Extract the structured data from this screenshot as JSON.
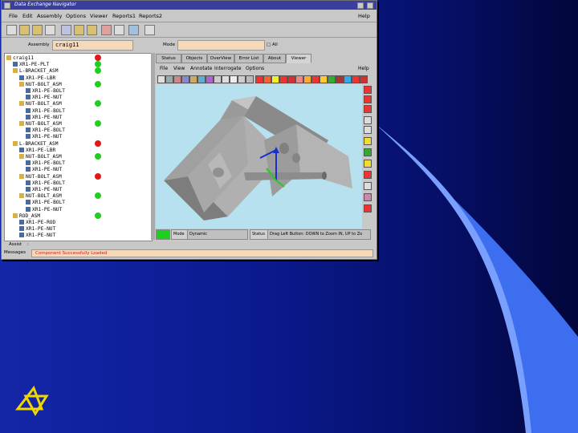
{
  "window": {
    "title": "Data Exchange Navigator",
    "menu": [
      "File",
      "Edit",
      "Assembly",
      "Options",
      "Viewer",
      "Reports1",
      "Reports2"
    ],
    "help": "Help"
  },
  "fields": {
    "assembly_label": "Assembly",
    "assembly_value": "craig11",
    "mode_label": "Mode",
    "mode_value": "",
    "all_label": "All"
  },
  "tree": {
    "items": [
      {
        "label": "craig11",
        "indent": 0,
        "status": "red"
      },
      {
        "label": "XR1-PE-PLT",
        "indent": 1,
        "status": "green"
      },
      {
        "label": "L-BRACKET_ASM",
        "indent": 1,
        "status": "green"
      },
      {
        "label": "XR1-PE-LBR",
        "indent": 2,
        "status": ""
      },
      {
        "label": "NUT-BOLT_ASM",
        "indent": 2,
        "status": "green"
      },
      {
        "label": "XR1-PE-BOLT",
        "indent": 3,
        "status": ""
      },
      {
        "label": "XR1-PE-NUT",
        "indent": 3,
        "status": ""
      },
      {
        "label": "NUT-BOLT_ASM",
        "indent": 2,
        "status": "green"
      },
      {
        "label": "XR1-PE-BOLT",
        "indent": 3,
        "status": ""
      },
      {
        "label": "XR1-PE-NUT",
        "indent": 3,
        "status": ""
      },
      {
        "label": "NUT-BOLT_ASM",
        "indent": 2,
        "status": "green"
      },
      {
        "label": "XR1-PE-BOLT",
        "indent": 3,
        "status": ""
      },
      {
        "label": "XR1-PE-NUT",
        "indent": 3,
        "status": ""
      },
      {
        "label": "L-BRACKET_ASM",
        "indent": 1,
        "status": "red"
      },
      {
        "label": "XR1-PE-LBR",
        "indent": 2,
        "status": ""
      },
      {
        "label": "NUT-BOLT_ASM",
        "indent": 2,
        "status": "green"
      },
      {
        "label": "XR1-PE-BOLT",
        "indent": 3,
        "status": ""
      },
      {
        "label": "XR1-PE-NUT",
        "indent": 3,
        "status": ""
      },
      {
        "label": "NUT-BOLT_ASM",
        "indent": 2,
        "status": "red"
      },
      {
        "label": "XR1-PE-BOLT",
        "indent": 3,
        "status": ""
      },
      {
        "label": "XR1-PE-NUT",
        "indent": 3,
        "status": ""
      },
      {
        "label": "NUT-BOLT_ASM",
        "indent": 2,
        "status": "green"
      },
      {
        "label": "XR1-PE-BOLT",
        "indent": 3,
        "status": ""
      },
      {
        "label": "XR1-PE-NUT",
        "indent": 3,
        "status": ""
      },
      {
        "label": "ROD_ASM",
        "indent": 1,
        "status": "green"
      },
      {
        "label": "XR1-PE-ROD",
        "indent": 2,
        "status": ""
      },
      {
        "label": "XR1-PE-NUT",
        "indent": 2,
        "status": ""
      },
      {
        "label": "XR1-PE-NUT",
        "indent": 2,
        "status": ""
      }
    ]
  },
  "tabs": [
    "Status",
    "Objects",
    "OverView",
    "Error List",
    "About",
    "Viewer"
  ],
  "viewer_menu": [
    "File",
    "View",
    "Annotate",
    "Interrogate",
    "Options"
  ],
  "viewer_help": "Help",
  "status": {
    "mode_label": "Mode",
    "mode_value": "Dynamic",
    "status_label": "Status",
    "status_value": "Drag Left Button: DOWN to Zoom IN, UP to Zo"
  },
  "bottom": {
    "assist_label": "Assist",
    "assist_value": ":",
    "messages_label": "Messages",
    "messages_value": "Component Successfully Loaded"
  },
  "colors": {
    "green": "#1fcf1f",
    "red": "#e01818"
  }
}
